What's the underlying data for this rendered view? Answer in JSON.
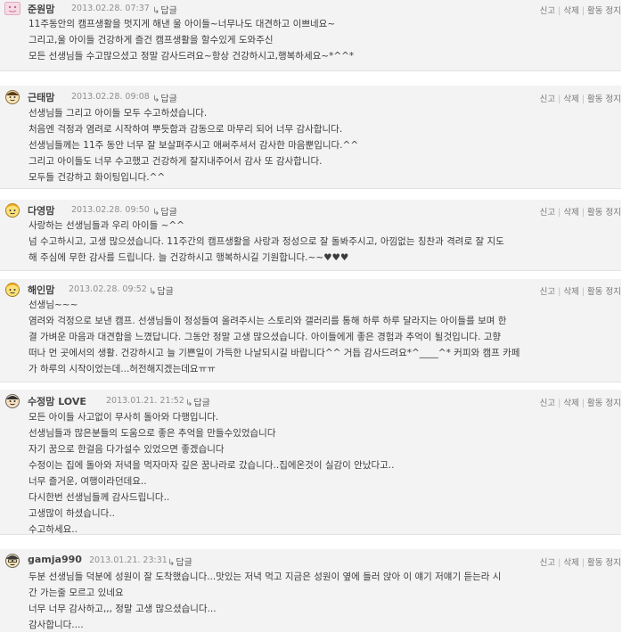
{
  "comments": [
    {
      "nick": "준원맘",
      "date": "2013.02.28. 07:37",
      "reply": "답글",
      "actions": [
        "신고",
        "삭제",
        "활동 정지"
      ],
      "lines": [
        "11주동안의 캠프생활을 멋지게 해낸 울 아이들~너무나도 대견하고 이쁘네요~",
        "그리고,울 아이들 건강하게 즐건 캠프생활을 할수있게 도와주신",
        "모든 선생님들 수고많으셨고 정말 감사드려요~항상 건강하시고,행복하세요~*^^*"
      ]
    },
    {
      "nick": "근태맘",
      "date": "2013.02.28. 09:08",
      "reply": "답글",
      "actions": [
        "신고",
        "삭제",
        "활동 정지"
      ],
      "lines": [
        "선생님들 그리고 아이들 모두 수고하셨습니다.",
        "처음엔 걱정과 염려로 시작하여 뿌듯함과 감동으로 마무리 되어 너무 감사합니다.",
        "선생님들께는 11주 동안 너무 잘 보살펴주시고 애써주셔서 감사한 마음뿐입니다.^^",
        "그리고 아이들도 너무 수고했고 건강하게 잘지내주어서 감사 또 감사합니다.",
        "모두들 건강하고 화이팅입니다.^^"
      ]
    },
    {
      "nick": "다영맘",
      "date": "2013.02.28. 09:50",
      "reply": "답글",
      "actions": [
        "신고",
        "삭제",
        "활동 정지"
      ],
      "lines": [
        "사랑하는 선생님들과 우리 아이들 ~^^",
        "넘 수고하시고, 고생 많으셨습니다. 11주간의 캠프생활을 사랑과 정성으로 잘 돌봐주시고, 아낌없는 칭찬과 격려로 잘 지도",
        "해 주심에 무한 감사를 드립니다. 늘 건강하시고 행복하시길 기원합니다.~~♥♥♥"
      ]
    },
    {
      "nick": "해인맘",
      "date": "2013.02.28. 09:52",
      "reply": "답글",
      "actions": [
        "신고",
        "삭제",
        "활동 정지"
      ],
      "lines": [
        "선생님~~~",
        "염려와 걱정으로 보낸 캠프. 선생님들이 정성들여 올려주시는 스토리와 갤러리를 통해 하루 하루 달라지는 아이들를 보며 한",
        "결 가벼운 마음과 대견함을 느꼈답니다. 그동안 정말 고생 많으셨습니다. 아이들에게 좋은 경험과 추억이 될것입니다. 고향",
        "떠나 먼 곳에서의 생활. 건강하시고 늘 기쁜일이 가득한 나날되시길 바랍니다^^ 거듭 감사드려요*^____^* 커피와 캠프 카페",
        "가 하루의 시작이었는데...허전해지겠는데요ㅠㅠ"
      ]
    },
    {
      "nick": "수정맘 LOVE",
      "date": "2013.01.21. 21:52",
      "reply": "답글",
      "actions": [
        "신고",
        "삭제",
        "활동 정지"
      ],
      "lines": [
        "모든 아이들 사고없이 무사히 돌아와 다행입니다.",
        "선생님들과 많은분들의 도움으로 좋은 추억을 만들수있었습니다",
        "자기 꿈으로 한걸음 다가설수 있었으면 좋겠습니다",
        "수정이는 집에 돌아와 저녁을 먹자마자 깊은 꿈나라로 갔습니다..집에온것이 실감이 안났다고..",
        "너무 즐거운, 여행이라던데요..",
        "다시한번 선생님들께 감사드립니다..",
        "고생많이 하셨습니다..",
        "수고하세요.."
      ]
    },
    {
      "nick": "gamja990",
      "date": "2013.01.21. 23:31",
      "reply": "답글",
      "actions": [
        "신고",
        "삭제",
        "활동 정지"
      ],
      "lines": [
        "두분 선생님들 덕분에 성원이 잘 도착했습니다...맛있는 저녁 먹고 지금은 성원이 옆에 들러 앉아 이 얘기 저얘기 듣는라 시",
        "간 가는줄 모르고 있네요",
        "너무 너무 감사하고,,, 정말 고생 많으셨습니다...",
        "감사합니다...."
      ]
    }
  ]
}
